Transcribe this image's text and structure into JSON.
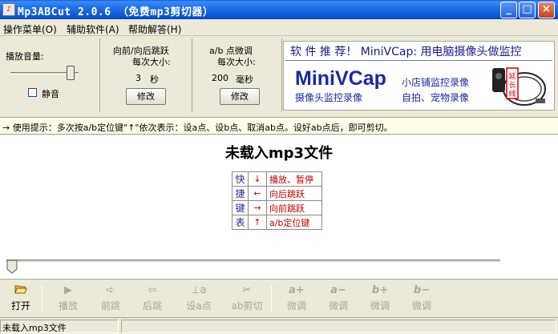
{
  "window": {
    "title": "Mp3ABCut  2.0.6  （免费mp3剪切器）",
    "min_label": "_",
    "max_label": "□",
    "close_label": "×"
  },
  "menu": [
    {
      "label": "操作菜单(O)"
    },
    {
      "label": "辅助软件(A)"
    },
    {
      "label": "帮助解答(H)"
    }
  ],
  "volume": {
    "label": "播放音量:",
    "level": 0.9,
    "mute_label": "静音",
    "mute_checked": false
  },
  "jump": {
    "label1": "向前/向后跳跃",
    "label2": "每次大小:",
    "value": "3",
    "unit": "秒",
    "button": "修改"
  },
  "ab_fine": {
    "label1": "a/b 点微调",
    "label2": "每次大小:",
    "value": "200",
    "unit": "毫秒",
    "button": "修改"
  },
  "ad": {
    "title": "软 件 推 荐！ MiniVCap: 用电脑摄像头做监控",
    "brand": "MiniVCap",
    "line1": "小店铺监控录像",
    "line2": "摄像头监控录像",
    "line3": "自拍、宠物录像",
    "badge": "延长线"
  },
  "tip": "→ 使用提示：多次按a/b定位键\"↑\"依次表示：设a点、设b点、取消ab点。设好ab点后，即可剪切。",
  "main": {
    "status_title": "未载入mp3文件",
    "shortcuts_chars": [
      "快",
      "捷",
      "键",
      "表"
    ],
    "shortcuts": [
      {
        "key": "↓",
        "action": "播放、暂停"
      },
      {
        "key": "←",
        "action": "向后跳跃"
      },
      {
        "key": "→",
        "action": "向前跳跃"
      },
      {
        "key": "↑",
        "action": "a/b定位键"
      }
    ],
    "seek_position": 0
  },
  "toolbar": [
    {
      "icon": "open-folder-icon",
      "label": "打开",
      "enabled": true
    },
    {
      "icon": "play-icon",
      "label": "播放",
      "enabled": false
    },
    {
      "icon": "forward-icon",
      "label": "前跳",
      "enabled": false
    },
    {
      "icon": "backward-icon",
      "label": "后跳",
      "enabled": false
    },
    {
      "icon": "set-a-icon",
      "label": "设a点",
      "enabled": false
    },
    {
      "icon": "cut-icon",
      "label": "ab剪切",
      "enabled": false
    },
    {
      "icon": "a-plus-icon",
      "glyph": "a+",
      "label": "微调",
      "enabled": false
    },
    {
      "icon": "a-minus-icon",
      "glyph": "a−",
      "label": "微调",
      "enabled": false
    },
    {
      "icon": "b-plus-icon",
      "glyph": "b+",
      "label": "微调",
      "enabled": false
    },
    {
      "icon": "b-minus-icon",
      "glyph": "b−",
      "label": "微调",
      "enabled": false
    }
  ],
  "status": {
    "text": "未载入mp3文件"
  }
}
